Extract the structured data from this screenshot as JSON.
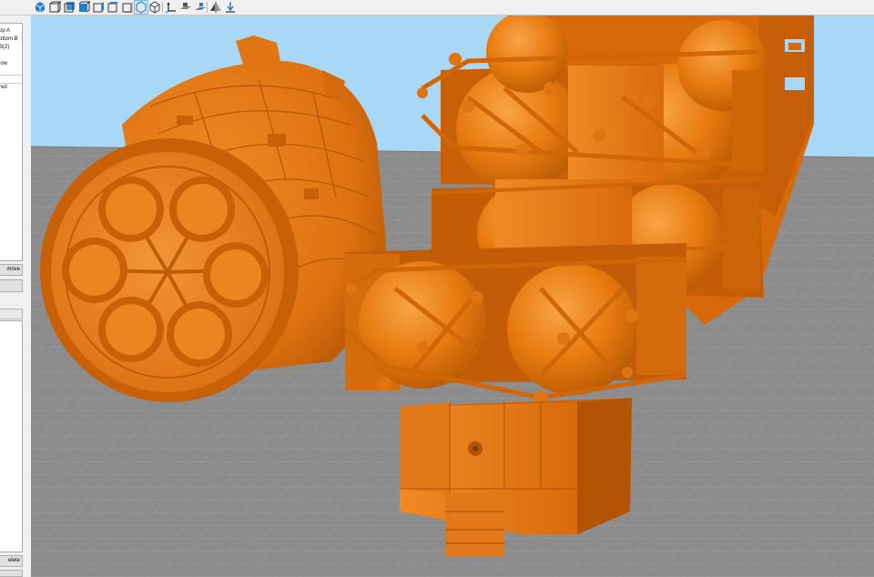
{
  "toolbar": {
    "buttons": [
      {
        "icon": "view-iso-icon"
      },
      {
        "icon": "view-front-icon"
      },
      {
        "icon": "view-back-icon"
      },
      {
        "icon": "view-left-icon"
      },
      {
        "icon": "view-right-icon"
      },
      {
        "icon": "view-top-icon"
      },
      {
        "icon": "view-bottom-icon"
      },
      {
        "icon": "perspective-icon"
      },
      {
        "icon": "wireframe-icon"
      },
      {
        "icon": "axes-icon"
      },
      {
        "icon": "build-plate-icon"
      },
      {
        "icon": "layflat-icon"
      },
      {
        "icon": "mirror-icon"
      },
      {
        "icon": "drop-to-plate-icon"
      }
    ]
  },
  "left_panel": {
    "objects": [
      "op A",
      "ottom B",
      "B(2)",
      "low",
      "red"
    ],
    "move_label": "move",
    "delete_label": "elete"
  },
  "colors": {
    "sky": "#a8d8f5",
    "floor": "#8c8c8c",
    "grid": "#9d9d9d",
    "model": "#e87a10",
    "model_dark": "#b95a05",
    "model_light": "#f59a3a"
  }
}
